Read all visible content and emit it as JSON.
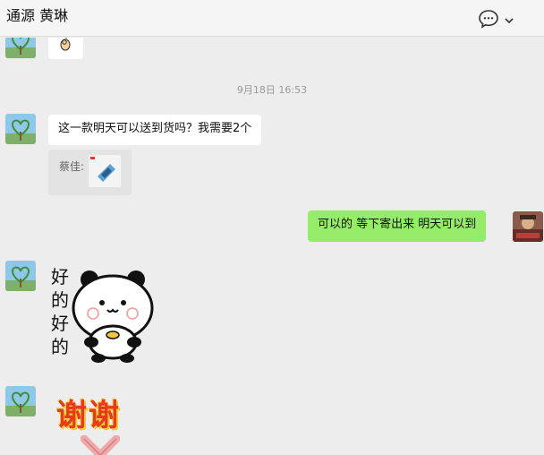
{
  "header": {
    "title": "通源 黄琳",
    "icons": [
      "chat-bubble-icon",
      "chevron-down-icon"
    ]
  },
  "messages": {
    "timestamp": "9月18日 16:53",
    "m1_text": "这一款明天可以送到货吗？我需要2个",
    "m1_quote_name": "蔡佳:",
    "m2_text": "可以的 等下寄出来 明天可以到",
    "sticker_text": [
      "好",
      "的",
      "好",
      "的"
    ],
    "thanks_text": "谢谢"
  },
  "colors": {
    "background": "#ededed",
    "bubble_out": "#95ec69",
    "bubble_in": "#ffffff",
    "thanks_red": "#e53b1a"
  }
}
